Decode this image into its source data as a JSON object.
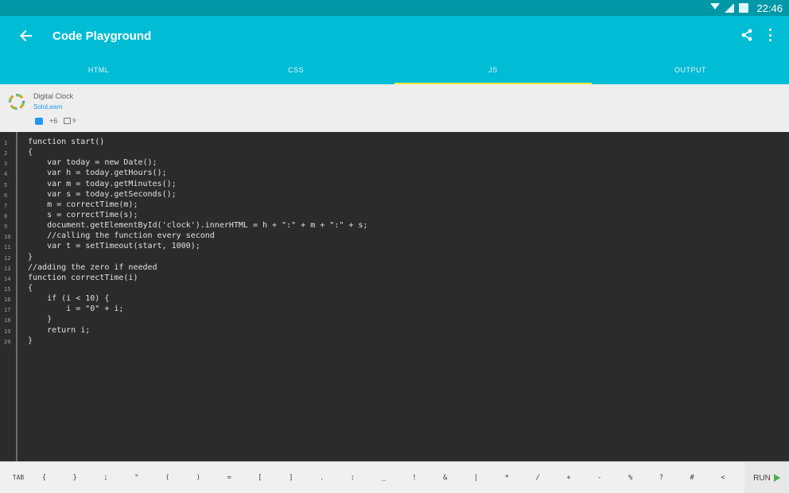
{
  "status": {
    "time": "22:46"
  },
  "app_bar": {
    "title": "Code Playground"
  },
  "tabs": [
    {
      "label": "HTML"
    },
    {
      "label": "CSS"
    },
    {
      "label": "JS"
    },
    {
      "label": "OUTPUT"
    }
  ],
  "active_tab": "JS",
  "info": {
    "name": "Digital Clock",
    "author": "SoloLearn",
    "votes": "+6",
    "comments": "9"
  },
  "colors": {
    "accent": "#00bcd4",
    "status_bar": "#0097a7",
    "tab_indicator": "#ffeb3b",
    "editor_bg": "#2b2b2b",
    "run": "#4caf50"
  },
  "editor": {
    "line_numbers": [
      "1",
      "2",
      "3",
      "4",
      "5",
      "6",
      "7",
      "8",
      "9",
      "10",
      "11",
      "12",
      "13",
      "14",
      "15",
      "16",
      "17",
      "18",
      "19",
      "20"
    ],
    "lines": [
      "function start()",
      "{",
      "    var today = new Date();",
      "    var h = today.getHours();",
      "    var m = today.getMinutes();",
      "    var s = today.getSeconds();",
      "    m = correctTime(m);",
      "    s = correctTime(s);",
      "    document.getElementById('clock').innerHTML = h + \":\" + m + \":\" + s;",
      "    //calling the function every second",
      "    var t = setTimeout(start, 1000);",
      "}",
      "//adding the zero if needed",
      "function correctTime(i)",
      "{",
      "    if (i < 10) {",
      "        i = \"0\" + i;",
      "    }",
      "    return i;",
      "}"
    ]
  },
  "key_bar": {
    "tab_label": "TAB",
    "keys": [
      "{",
      "}",
      ";",
      "\"",
      "(",
      ")",
      "=",
      "[",
      "]",
      ".",
      ":",
      "_",
      "!",
      "&",
      "|",
      "*",
      "/",
      "+",
      "-",
      "%",
      "?",
      "#",
      "<"
    ],
    "run_label": "RUN"
  }
}
